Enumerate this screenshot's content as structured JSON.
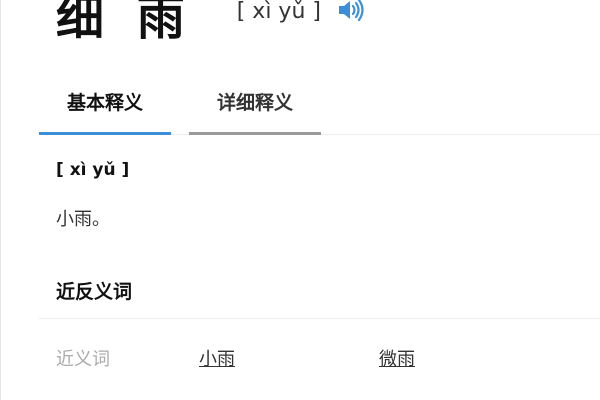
{
  "word": {
    "title": "细 雨",
    "pinyin": "[ xì yǔ ]",
    "audio_icon": "speaker-icon",
    "accent_color": "#3b8fd9"
  },
  "tabs": [
    {
      "label": "基本释义",
      "active": true
    },
    {
      "label": "详细释义",
      "active": false
    }
  ],
  "basic_definition": {
    "pinyin": "[ xì yǔ ]",
    "text": "小雨。"
  },
  "synonyms_antonyms": {
    "title": "近反义词",
    "synonyms_label": "近义词",
    "synonyms": [
      "小雨",
      "微雨"
    ]
  }
}
